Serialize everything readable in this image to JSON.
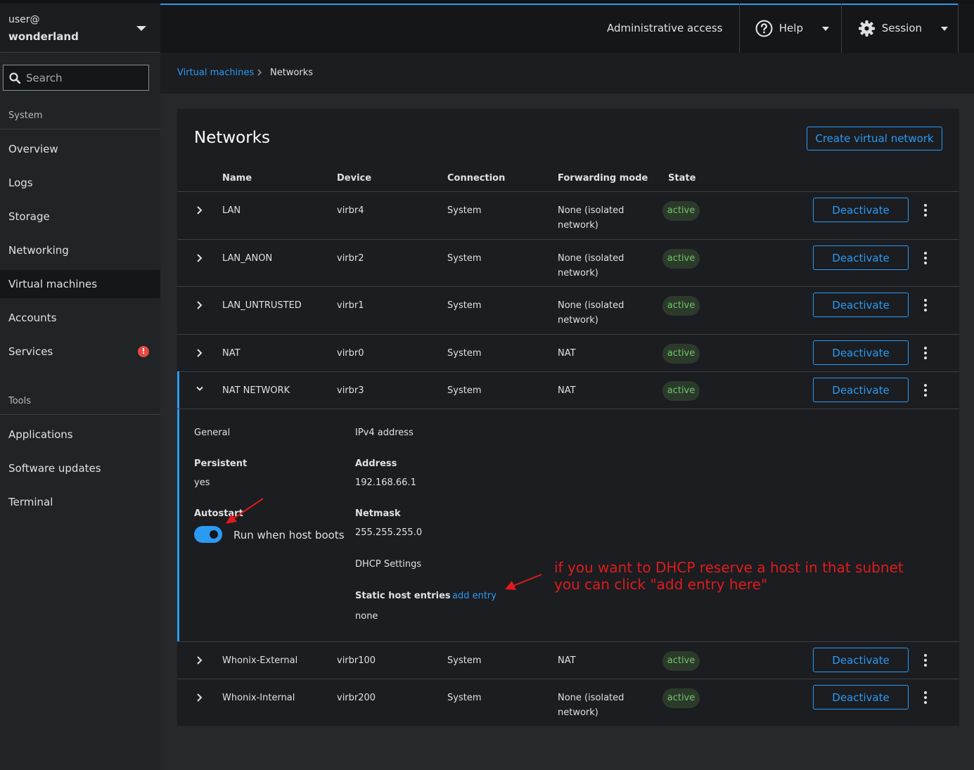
{
  "host": {
    "user": "user@",
    "name": "wonderland"
  },
  "search": {
    "placeholder": "Search"
  },
  "sidebar": {
    "system_label": "System",
    "tools_label": "Tools",
    "system_items": [
      {
        "label": "Overview"
      },
      {
        "label": "Logs"
      },
      {
        "label": "Storage"
      },
      {
        "label": "Networking"
      },
      {
        "label": "Virtual machines"
      },
      {
        "label": "Accounts"
      },
      {
        "label": "Services",
        "alert": "!"
      }
    ],
    "tool_items": [
      {
        "label": "Applications"
      },
      {
        "label": "Software updates"
      },
      {
        "label": "Terminal"
      }
    ]
  },
  "topbar": {
    "admin": "Administrative access",
    "help": "Help",
    "session": "Session"
  },
  "breadcrumb": {
    "parent": "Virtual machines",
    "current": "Networks"
  },
  "page": {
    "title": "Networks",
    "create_button": "Create virtual network"
  },
  "table": {
    "headers": {
      "name": "Name",
      "device": "Device",
      "connection": "Connection",
      "forwarding": "Forwarding mode",
      "state": "State"
    },
    "action_label": "Deactivate",
    "rows": [
      {
        "name": "LAN",
        "device": "virbr4",
        "connection": "System",
        "forwarding_1": "None (isolated",
        "forwarding_2": "network)",
        "state": "active"
      },
      {
        "name": "LAN_ANON",
        "device": "virbr2",
        "connection": "System",
        "forwarding_1": "None (isolated",
        "forwarding_2": "network)",
        "state": "active"
      },
      {
        "name": "LAN_UNTRUSTED",
        "device": "virbr1",
        "connection": "System",
        "forwarding_1": "None (isolated",
        "forwarding_2": "network)",
        "state": "active"
      },
      {
        "name": "NAT",
        "device": "virbr0",
        "connection": "System",
        "forwarding_1": "NAT",
        "forwarding_2": "",
        "state": "active"
      },
      {
        "name": "NAT NETWORK",
        "device": "virbr3",
        "connection": "System",
        "forwarding_1": "NAT",
        "forwarding_2": "",
        "state": "active"
      },
      {
        "name": "Whonix-External",
        "device": "virbr100",
        "connection": "System",
        "forwarding_1": "NAT",
        "forwarding_2": "",
        "state": "active"
      },
      {
        "name": "Whonix-Internal",
        "device": "virbr200",
        "connection": "System",
        "forwarding_1": "None (isolated",
        "forwarding_2": "network)",
        "state": "active"
      }
    ]
  },
  "details": {
    "general": "General",
    "persistent_label": "Persistent",
    "persistent_value": "yes",
    "autostart_label": "Autostart",
    "autostart_text": "Run when host boots",
    "ipv4": "IPv4 address",
    "address_label": "Address",
    "address_value": "192.168.66.1",
    "netmask_label": "Netmask",
    "netmask_value": "255.255.255.0",
    "dhcp": "DHCP Settings",
    "static_label": "Static host entries",
    "add_entry": "add entry",
    "static_value": "none"
  },
  "annotation": {
    "line1": "if you want to DHCP reserve a host in that subnet",
    "line2": "you can click \"add entry here\"",
    "color": "#e01b1b"
  },
  "colors": {
    "accent": "#2b9af3",
    "active_green": "#6ec664",
    "alert": "#e64a41"
  }
}
